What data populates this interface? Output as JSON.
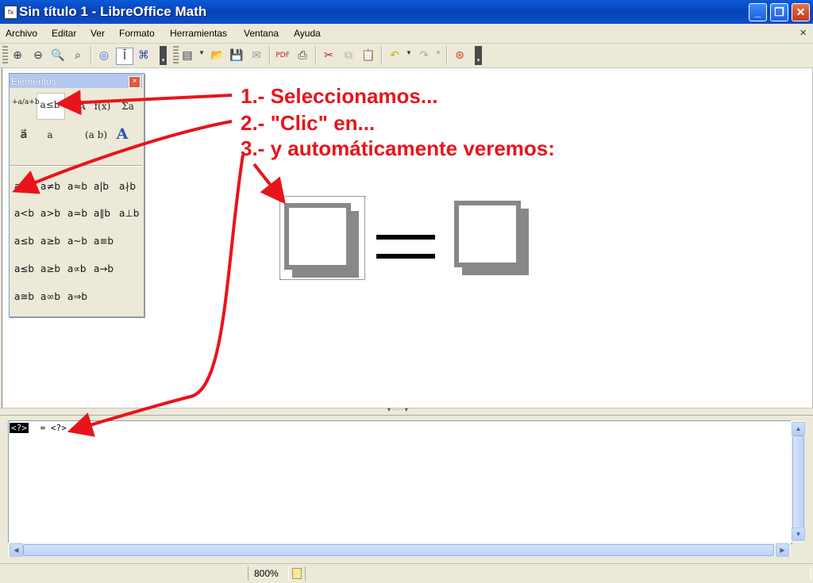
{
  "window": {
    "title": "Sin título 1 - LibreOffice Math",
    "app_icon": "math-app-icon",
    "controls": [
      "minimize",
      "restore",
      "close"
    ]
  },
  "menubar": {
    "items": [
      "Archivo",
      "Editar",
      "Ver",
      "Formato",
      "Herramientas",
      "Ventana",
      "Ayuda"
    ],
    "close_doc": "×"
  },
  "elements_panel": {
    "title": "Elementos",
    "categories": [
      "+a/a+b",
      "a≤b",
      "∈A",
      "f(x)",
      "Σa",
      "a⃗",
      "a",
      "(a b)",
      "A"
    ],
    "relations": [
      [
        "a=b",
        "a≠b",
        "a≈b",
        "a|b",
        "a∤b"
      ],
      [
        "a<b",
        "a>b",
        "a≃b",
        "a∥b",
        "a⊥b"
      ],
      [
        "a≤b",
        "a≥b",
        "a~b",
        "a≡b"
      ],
      [
        "a≤b",
        "a≥b",
        "a∝b",
        "a→b"
      ],
      [
        "a≅b",
        "a∞b",
        "a⇒b"
      ]
    ]
  },
  "annotations": {
    "step1": "1.- Seleccionamos...",
    "step2": "2.- \"Clic\" en...",
    "step3": "3.- y automáticamente veremos:",
    "color": "#e8141c"
  },
  "command": {
    "selected": "<?>",
    "rest": " = <?>"
  },
  "status": {
    "zoom": "800%"
  }
}
